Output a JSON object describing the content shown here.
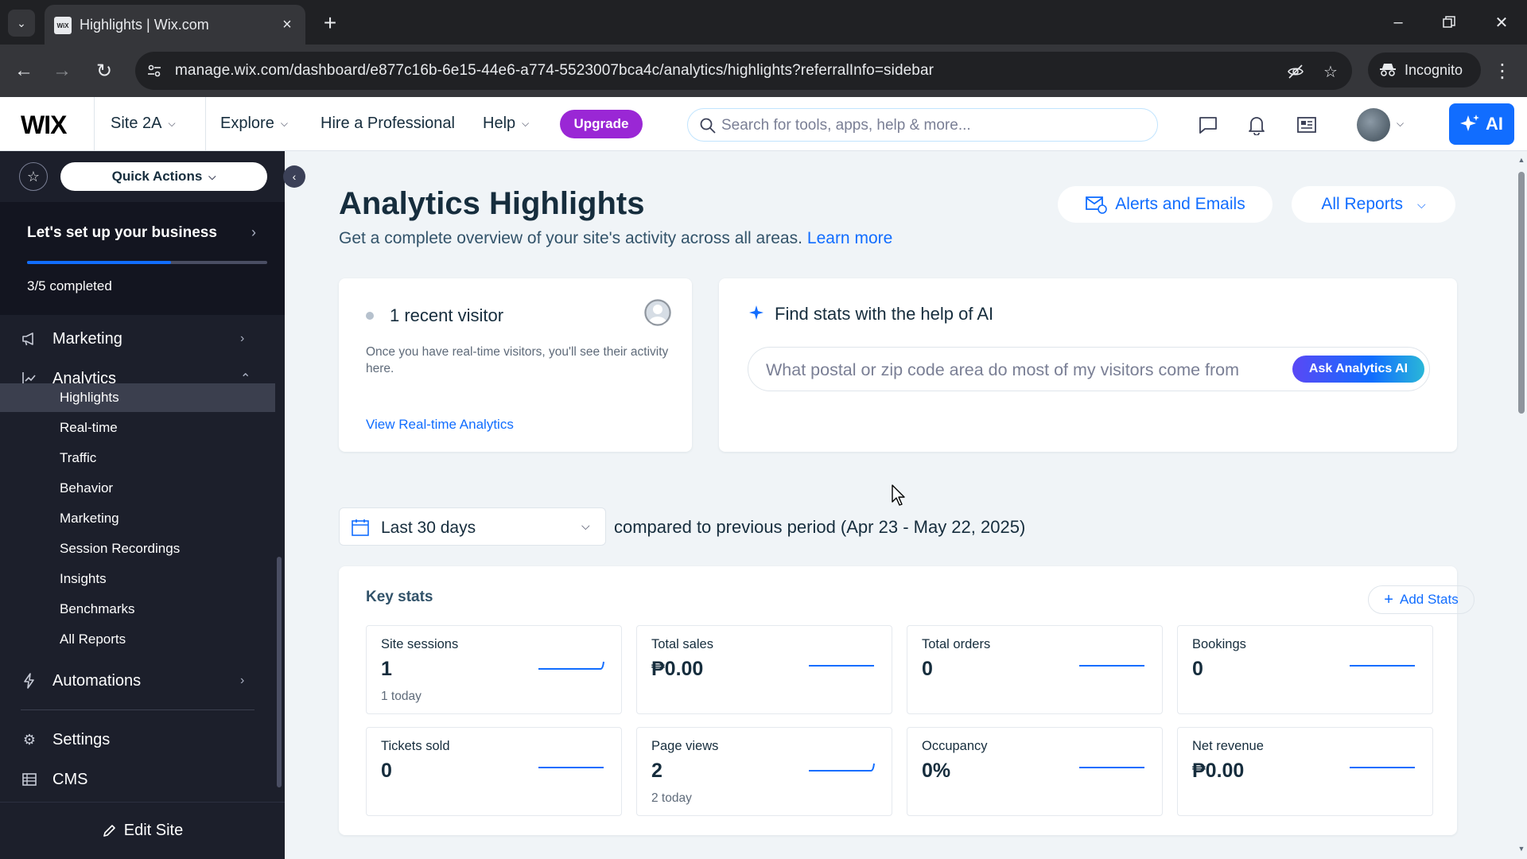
{
  "browser": {
    "tab_title": "Highlights | Wix.com",
    "tab_favicon": "WiX",
    "url": "manage.wix.com/dashboard/e877c16b-6e15-44e6-a774-5523007bca4c/analytics/highlights?referralInfo=sidebar",
    "incognito_label": "Incognito"
  },
  "topbar": {
    "logo": "WIX",
    "site_name": "Site 2A",
    "explore": "Explore",
    "hire": "Hire a Professional",
    "help": "Help",
    "upgrade": "Upgrade",
    "search_placeholder": "Search for tools, apps, help & more...",
    "ai_label": "AI"
  },
  "sidebar": {
    "quick_actions": "Quick Actions",
    "setup_title": "Let's set up your business",
    "setup_progress": 0.6,
    "setup_count": "3/5 completed",
    "items": {
      "marketing": "Marketing",
      "analytics": "Analytics",
      "automations": "Automations",
      "settings": "Settings",
      "cms": "CMS"
    },
    "analytics_sub": [
      "Highlights",
      "Real-time",
      "Traffic",
      "Behavior",
      "Marketing",
      "Session Recordings",
      "Insights",
      "Benchmarks",
      "All Reports"
    ],
    "edit_site": "Edit Site"
  },
  "main": {
    "title": "Analytics Highlights",
    "subtitle": "Get a complete overview of your site's activity across all areas.",
    "learn_more": "Learn more",
    "alerts_button": "Alerts and Emails",
    "reports_button": "All Reports",
    "visitor_card": {
      "title": "1 recent visitor",
      "description": "Once you have real-time visitors, you'll see their activity here.",
      "link": "View Real-time Analytics"
    },
    "ai_card": {
      "title": "Find stats with the help of AI",
      "placeholder": "What postal or zip code area do most of my visitors come from",
      "button": "Ask Analytics AI"
    },
    "date_range": "Last 30 days",
    "compare_text": "compared to previous period (Apr 23 - May 22, 2025)",
    "key_stats": {
      "title": "Key stats",
      "add_button": "Add Stats",
      "stats": [
        {
          "label": "Site sessions",
          "value": "1",
          "sub": "1 today"
        },
        {
          "label": "Total sales",
          "value": "₱0.00",
          "sub": ""
        },
        {
          "label": "Total orders",
          "value": "0",
          "sub": ""
        },
        {
          "label": "Bookings",
          "value": "0",
          "sub": ""
        },
        {
          "label": "Tickets sold",
          "value": "0",
          "sub": ""
        },
        {
          "label": "Page views",
          "value": "2",
          "sub": "2 today"
        },
        {
          "label": "Occupancy",
          "value": "0%",
          "sub": ""
        },
        {
          "label": "Net revenue",
          "value": "₱0.00",
          "sub": ""
        }
      ]
    }
  },
  "colors": {
    "accent": "#116dff",
    "upgrade": "#9a27d5",
    "sidebar_bg": "#1c1f2b"
  }
}
